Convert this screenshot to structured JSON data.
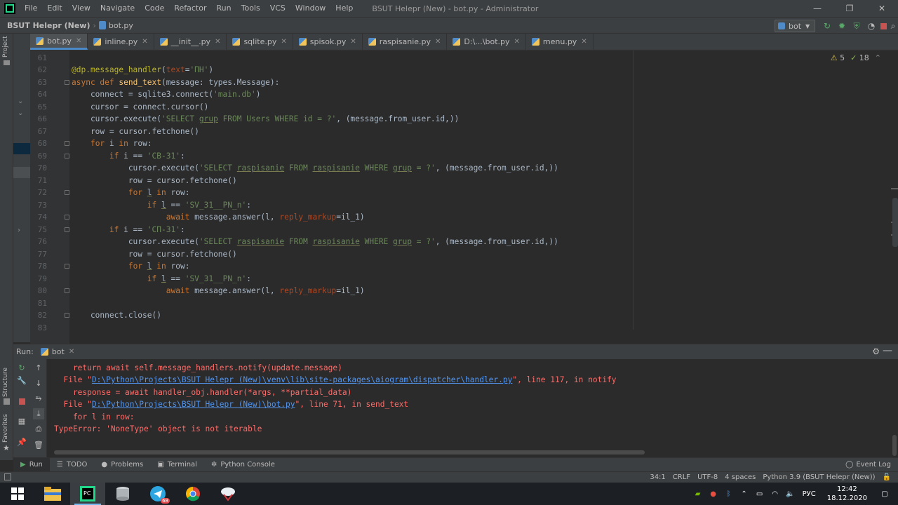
{
  "menu": {
    "items": [
      "File",
      "Edit",
      "View",
      "Navigate",
      "Code",
      "Refactor",
      "Run",
      "Tools",
      "VCS",
      "Window",
      "Help"
    ],
    "window_title": "BSUT Helepr (New) - bot.py - Administrator"
  },
  "nav": {
    "project": "BSUT Helepr (New)",
    "file": "bot.py",
    "run_config": "bot"
  },
  "tabs": [
    {
      "label": "bot.py",
      "active": true
    },
    {
      "label": "inline.py"
    },
    {
      "label": "__init__.py"
    },
    {
      "label": "sqlite.py"
    },
    {
      "label": "spisok.py"
    },
    {
      "label": "raspisanie.py"
    },
    {
      "label": "D:\\...\\bot.py"
    },
    {
      "label": "menu.py"
    }
  ],
  "inspections": {
    "warnings": "5",
    "weak_warnings": "18"
  },
  "left_strip": {
    "project": "Project",
    "structure": "Structure",
    "favorites": "Favorites"
  },
  "line_numbers": [
    "61",
    "62",
    "63",
    "64",
    "65",
    "66",
    "67",
    "68",
    "69",
    "70",
    "71",
    "72",
    "73",
    "74",
    "75",
    "76",
    "77",
    "78",
    "79",
    "80",
    "81",
    "82",
    "83"
  ],
  "run_panel": {
    "label": "Run:",
    "tab": "bot"
  },
  "console": {
    "l1": "    return await self.message_handlers.notify(update.message)",
    "l2_pre": "  File \"",
    "l2_link": "D:\\Python\\Projects\\BSUT Helepr (New)\\venv\\lib\\site-packages\\aiogram\\dispatcher\\handler.py",
    "l2_post": "\", line 117, in notify",
    "l3": "    response = await handler_obj.handler(*args, **partial_data)",
    "l4_pre": "  File \"",
    "l4_link": "D:\\Python\\Projects\\BSUT Helepr (New)\\bot.py",
    "l4_post": "\", line 71, in send_text",
    "l5": "    for l in row:",
    "l6": "TypeError: 'NoneType' object is not iterable"
  },
  "bottom_tabs": {
    "run": "Run",
    "todo": "TODO",
    "problems": "Problems",
    "terminal": "Terminal",
    "python_console": "Python Console",
    "event_log": "Event Log"
  },
  "status": {
    "position": "34:1",
    "line_sep": "CRLF",
    "encoding": "UTF-8",
    "indent": "4 spaces",
    "interpreter": "Python 3.9 (BSUT Helepr (New))"
  },
  "taskbar": {
    "language": "РУС",
    "time": "12:42",
    "date": "18.12.2020",
    "telegram_badge": "68"
  },
  "colors": {
    "editor_bg": "#2b2b2b",
    "panel_bg": "#3c3f41",
    "keyword": "#cc7832",
    "string": "#6a8759",
    "error": "#ff6b68",
    "link": "#5394ec"
  }
}
